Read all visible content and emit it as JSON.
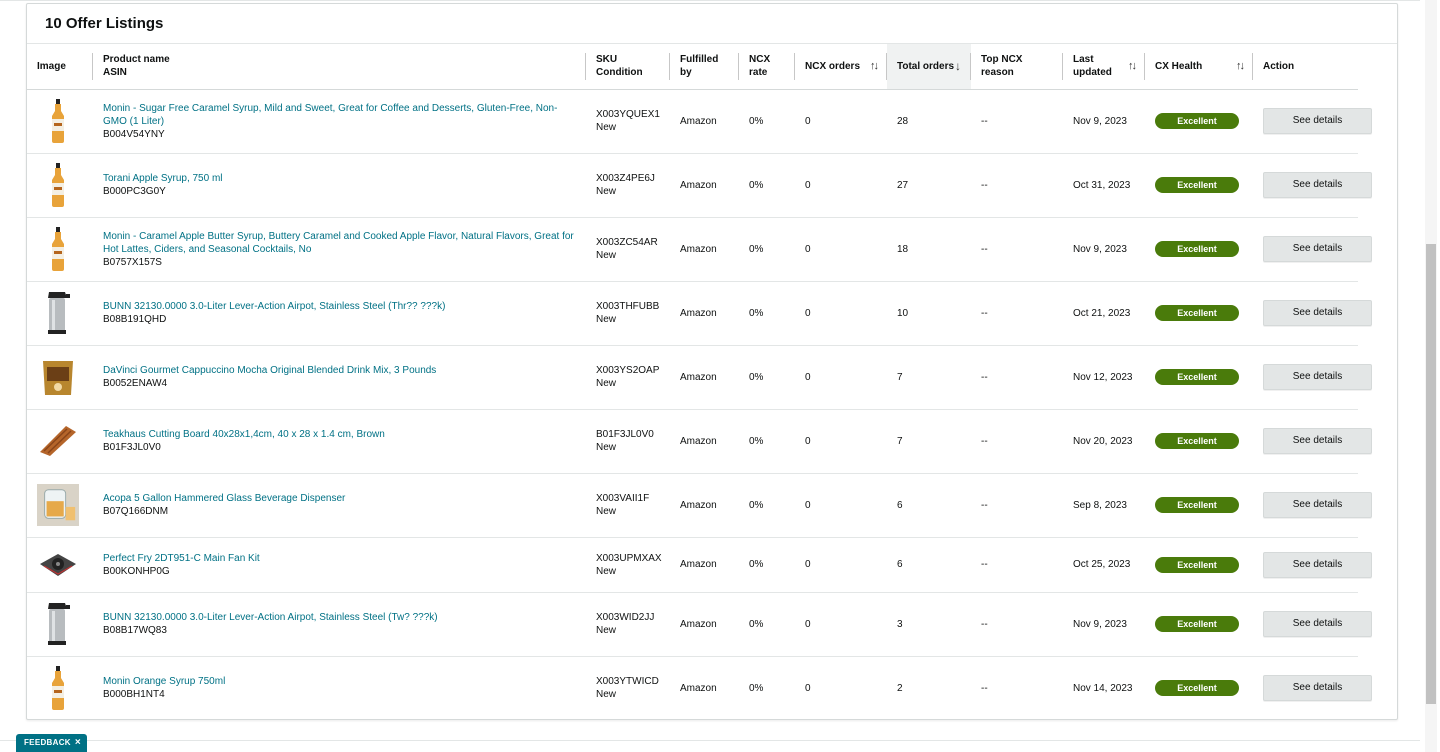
{
  "panel": {
    "title": "10 Offer Listings"
  },
  "columns": {
    "image": "Image",
    "product_name": "Product name",
    "asin": "ASIN",
    "sku": "SKU",
    "condition": "Condition",
    "fulfilled_by": "Fulfilled by",
    "ncx_rate": "NCX rate",
    "ncx_orders": "NCX orders",
    "total_orders": "Total orders",
    "top_ncx_1": "Top NCX",
    "top_ncx_2": "reason",
    "last_updated": "Last updated",
    "cx_health": "CX Health",
    "action": "Action"
  },
  "rows": [
    {
      "name": "Monin - Sugar Free Caramel Syrup, Mild and Sweet, Great for Coffee and Desserts, Gluten-Free, Non-GMO (1 Liter)",
      "asin": "B004V54YNY",
      "sku": "X003YQUEX1",
      "condition": "New",
      "fulfilled": "Amazon",
      "ncx_rate": "0%",
      "ncx_orders": "0",
      "total_orders": "28",
      "top_ncx": "--",
      "updated": "Nov 9, 2023",
      "health": "Excellent",
      "action": "See details",
      "icon": "syrup-bottle-icon"
    },
    {
      "name": "Torani Apple Syrup, 750 ml",
      "asin": "B000PC3G0Y",
      "sku": "X003Z4PE6J",
      "condition": "New",
      "fulfilled": "Amazon",
      "ncx_rate": "0%",
      "ncx_orders": "0",
      "total_orders": "27",
      "top_ncx": "--",
      "updated": "Oct 31, 2023",
      "health": "Excellent",
      "action": "See details",
      "icon": "syrup-bottle-icon"
    },
    {
      "name": "Monin - Caramel Apple Butter Syrup, Buttery Caramel and Cooked Apple Flavor, Natural Flavors, Great for Hot Lattes, Ciders, and Seasonal Cocktails, No",
      "asin": "B0757X157S",
      "sku": "X003ZC54AR",
      "condition": "New",
      "fulfilled": "Amazon",
      "ncx_rate": "0%",
      "ncx_orders": "0",
      "total_orders": "18",
      "top_ncx": "--",
      "updated": "Nov 9, 2023",
      "health": "Excellent",
      "action": "See details",
      "icon": "syrup-bottle-icon"
    },
    {
      "name": "BUNN 32130.0000 3.0-Liter Lever-Action Airpot, Stainless Steel (Thr?? ???k)",
      "asin": "B08B191QHD",
      "sku": "X003THFUBB",
      "condition": "New",
      "fulfilled": "Amazon",
      "ncx_rate": "0%",
      "ncx_orders": "0",
      "total_orders": "10",
      "top_ncx": "--",
      "updated": "Oct 21, 2023",
      "health": "Excellent",
      "action": "See details",
      "icon": "airpot-icon"
    },
    {
      "name": "DaVinci Gourmet Cappuccino Mocha Original Blended Drink Mix, 3 Pounds",
      "asin": "B0052ENAW4",
      "sku": "X003YS2OAP",
      "condition": "New",
      "fulfilled": "Amazon",
      "ncx_rate": "0%",
      "ncx_orders": "0",
      "total_orders": "7",
      "top_ncx": "--",
      "updated": "Nov 12, 2023",
      "health": "Excellent",
      "action": "See details",
      "icon": "drink-mix-bag-icon"
    },
    {
      "name": "Teakhaus Cutting Board 40x28x1,4cm, 40 x 28 x 1.4 cm, Brown",
      "asin": "B01F3JL0V0",
      "sku": "B01F3JL0V0",
      "condition": "New",
      "fulfilled": "Amazon",
      "ncx_rate": "0%",
      "ncx_orders": "0",
      "total_orders": "7",
      "top_ncx": "--",
      "updated": "Nov 20, 2023",
      "health": "Excellent",
      "action": "See details",
      "icon": "cutting-board-icon"
    },
    {
      "name": "Acopa 5 Gallon Hammered Glass Beverage Dispenser",
      "asin": "B07Q166DNM",
      "sku": "X003VAII1F",
      "condition": "New",
      "fulfilled": "Amazon",
      "ncx_rate": "0%",
      "ncx_orders": "0",
      "total_orders": "6",
      "top_ncx": "--",
      "updated": "Sep 8, 2023",
      "health": "Excellent",
      "action": "See details",
      "icon": "beverage-dispenser-icon"
    },
    {
      "name": "Perfect Fry 2DT951-C Main Fan Kit",
      "asin": "B00KONHP0G",
      "sku": "X003UPMXAX",
      "condition": "New",
      "fulfilled": "Amazon",
      "ncx_rate": "0%",
      "ncx_orders": "0",
      "total_orders": "6",
      "top_ncx": "--",
      "updated": "Oct 25, 2023",
      "health": "Excellent",
      "action": "See details",
      "icon": "fan-kit-icon"
    },
    {
      "name": "BUNN 32130.0000 3.0-Liter Lever-Action Airpot, Stainless Steel (Tw? ???k)",
      "asin": "B08B17WQ83",
      "sku": "X003WID2JJ",
      "condition": "New",
      "fulfilled": "Amazon",
      "ncx_rate": "0%",
      "ncx_orders": "0",
      "total_orders": "3",
      "top_ncx": "--",
      "updated": "Nov 9, 2023",
      "health": "Excellent",
      "action": "See details",
      "icon": "airpot-icon"
    },
    {
      "name": "Monin Orange Syrup 750ml",
      "asin": "B000BH1NT4",
      "sku": "X003YTWICD",
      "condition": "New",
      "fulfilled": "Amazon",
      "ncx_rate": "0%",
      "ncx_orders": "0",
      "total_orders": "2",
      "top_ncx": "--",
      "updated": "Nov 14, 2023",
      "health": "Excellent",
      "action": "See details",
      "icon": "syrup-bottle-icon"
    }
  ],
  "feedback": {
    "label": "FEEDBACK",
    "close": "×"
  },
  "colors": {
    "link": "#007185",
    "excellent": "#4a7b0b",
    "button": "#e3e6e6"
  }
}
